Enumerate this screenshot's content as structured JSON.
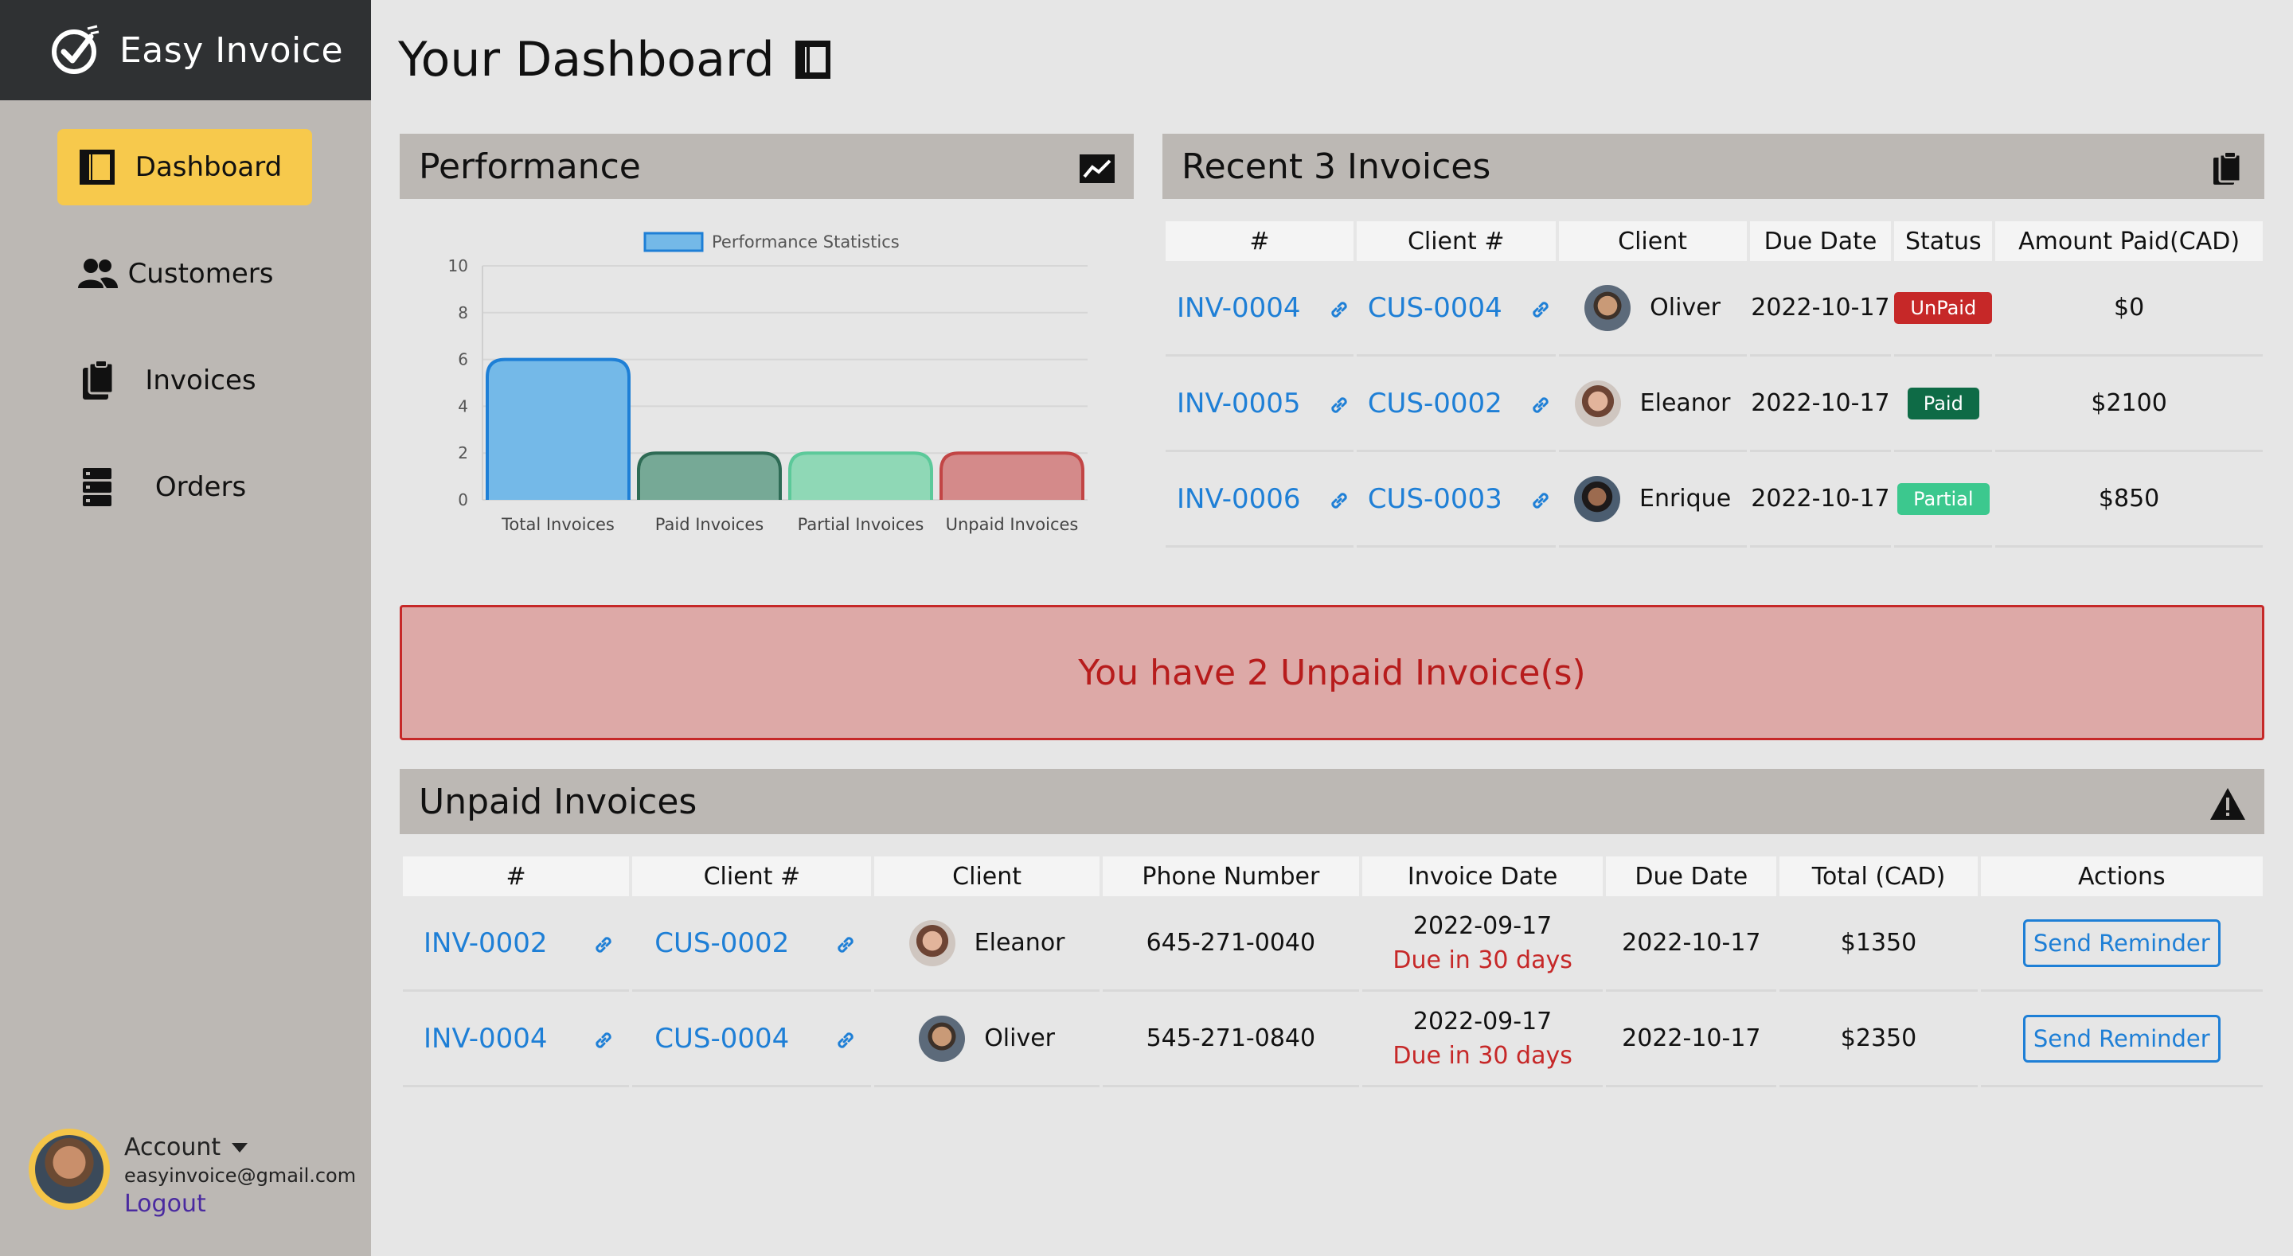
{
  "brand": {
    "name": "Easy Invoice",
    "logo_icon": "check-circle-icon"
  },
  "sidebar": {
    "items": [
      {
        "label": "Dashboard",
        "icon": "dashboard-icon",
        "active": true
      },
      {
        "label": "Customers",
        "icon": "users-icon",
        "active": false
      },
      {
        "label": "Invoices",
        "icon": "invoices-icon",
        "active": false
      },
      {
        "label": "Orders",
        "icon": "orders-icon",
        "active": false
      }
    ]
  },
  "account": {
    "title": "Account",
    "email": "easyinvoice@gmail.com",
    "logout": "Logout"
  },
  "page": {
    "title": "Your Dashboard"
  },
  "performance": {
    "title": "Performance",
    "icon": "chart-line-icon"
  },
  "chart_data": {
    "type": "bar",
    "categories": [
      "Total Invoices",
      "Paid Invoices",
      "Partial Invoices",
      "Unpaid Invoices"
    ],
    "series": [
      {
        "name": "Performance Statistics",
        "values": [
          6,
          2,
          2,
          2
        ]
      }
    ],
    "bar_colors": [
      "#74b9e8",
      "#76a996",
      "#8fd8b6",
      "#d48a8a"
    ],
    "bar_borders": [
      "#1e7fd6",
      "#2e6b55",
      "#5cc99a",
      "#c24545"
    ],
    "ylim": [
      0,
      10
    ],
    "yticks": [
      0,
      2,
      4,
      6,
      8,
      10
    ],
    "grid": true,
    "legend": "top-center"
  },
  "recent": {
    "title": "Recent 3 Invoices",
    "icon": "clipboard-icon",
    "headers": [
      "#",
      "Client #",
      "Client",
      "Due Date",
      "Status",
      "Amount Paid(CAD)"
    ],
    "rows": [
      {
        "invoice": "INV-0004",
        "client_id": "CUS-0004",
        "client": "Oliver",
        "avatar": "av-oliver",
        "due": "2022-10-17",
        "status": "UnPaid",
        "status_class": "status-unpaid",
        "amount": "$0"
      },
      {
        "invoice": "INV-0005",
        "client_id": "CUS-0002",
        "client": "Eleanor",
        "avatar": "av-eleanor",
        "due": "2022-10-17",
        "status": "Paid",
        "status_class": "status-paid",
        "amount": "$2100"
      },
      {
        "invoice": "INV-0006",
        "client_id": "CUS-0003",
        "client": "Enrique",
        "avatar": "av-enrique",
        "due": "2022-10-17",
        "status": "Partial",
        "status_class": "status-partial",
        "amount": "$850"
      }
    ]
  },
  "alert": {
    "text": "You have 2 Unpaid Invoice(s)"
  },
  "unpaid": {
    "title": "Unpaid Invoices",
    "icon": "warning-icon",
    "headers": [
      "#",
      "Client #",
      "Client",
      "Phone Number",
      "Invoice Date",
      "Due Date",
      "Total (CAD)",
      "Actions"
    ],
    "rows": [
      {
        "invoice": "INV-0002",
        "client_id": "CUS-0002",
        "client": "Eleanor",
        "avatar": "av-eleanor",
        "phone": "645-271-0040",
        "invoice_date": "2022-09-17",
        "due_note": "Due in 30 days",
        "due": "2022-10-17",
        "total": "$1350",
        "action": "Send Reminder"
      },
      {
        "invoice": "INV-0004",
        "client_id": "CUS-0004",
        "client": "Oliver",
        "avatar": "av-oliver",
        "phone": "545-271-0840",
        "invoice_date": "2022-09-17",
        "due_note": "Due in 30 days",
        "due": "2022-10-17",
        "total": "$2350",
        "action": "Send Reminder"
      }
    ]
  }
}
